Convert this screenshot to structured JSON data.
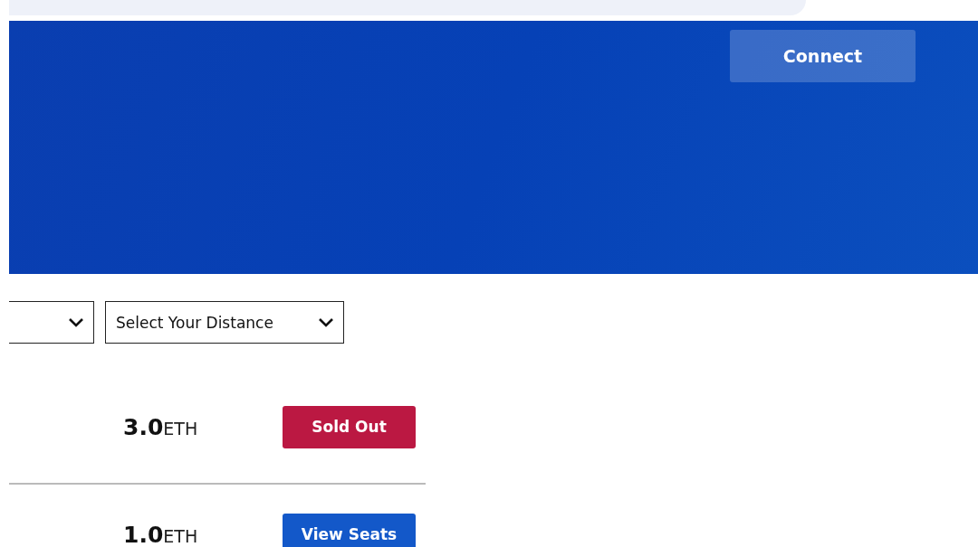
{
  "header": {
    "connect_button": "Connect"
  },
  "filters": [
    {
      "kind": "select"
    },
    {
      "kind": "select",
      "value": "Select Your Distance"
    }
  ],
  "tickets": [
    {
      "price": "3.0",
      "unit": "ETH",
      "action": {
        "kind": "sold_out",
        "label": "Sold Out"
      }
    },
    {
      "price": "1.0",
      "unit": "ETH",
      "action": {
        "kind": "available",
        "label": "View Seats"
      }
    }
  ]
}
